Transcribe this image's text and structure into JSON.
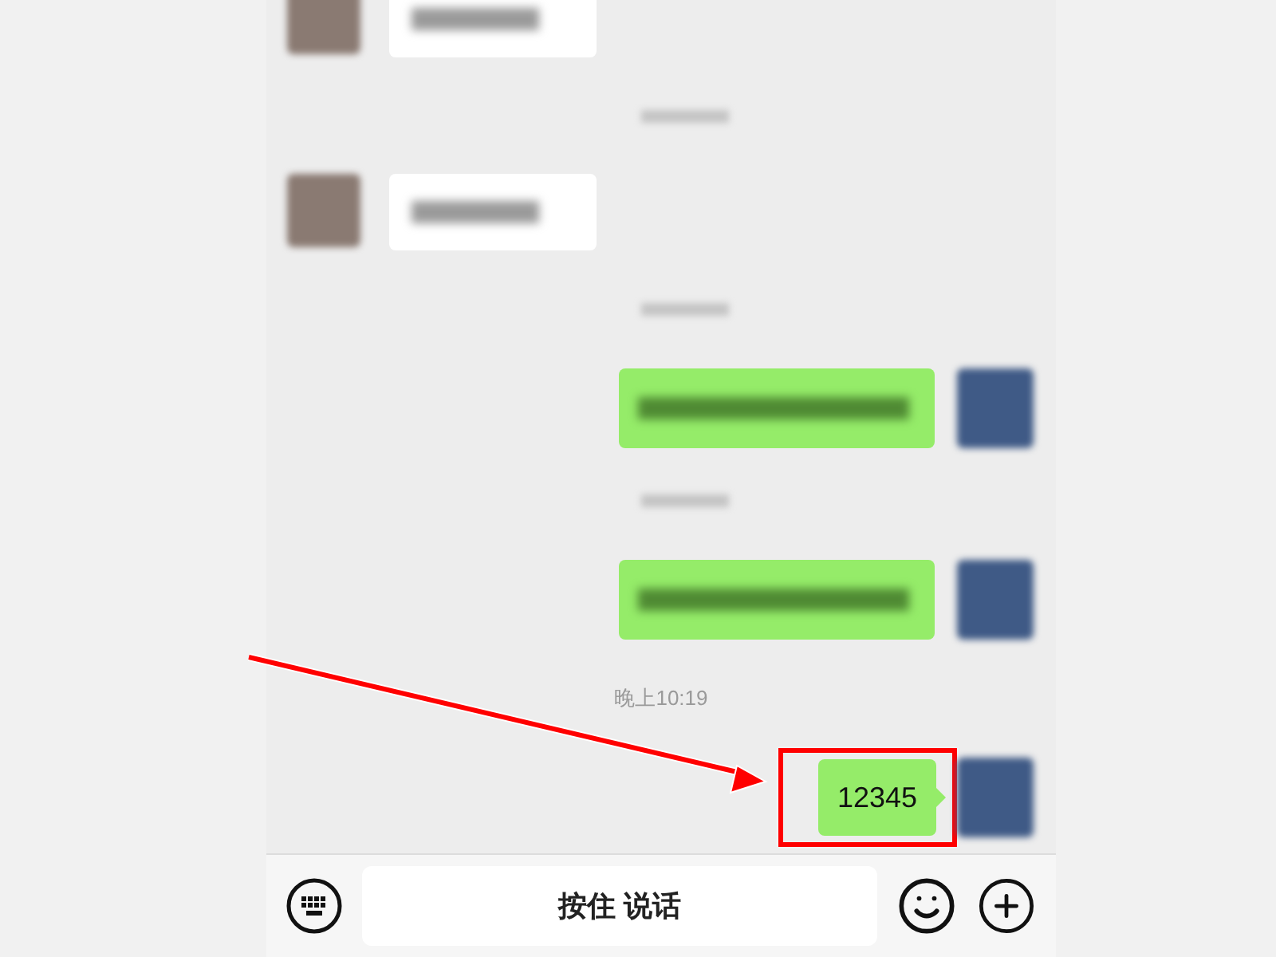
{
  "messages": [
    {
      "kind": "received"
    },
    {
      "kind": "time_blurred"
    },
    {
      "kind": "received"
    },
    {
      "kind": "time_blurred"
    },
    {
      "kind": "sent",
      "annotated": false
    },
    {
      "kind": "time_blurred"
    },
    {
      "kind": "sent",
      "annotated": false
    },
    {
      "kind": "time",
      "text": "晚上10:19"
    },
    {
      "kind": "sent",
      "text": "12345",
      "annotated": true
    }
  ],
  "input_bar": {
    "voice_button": "按住 说话"
  }
}
